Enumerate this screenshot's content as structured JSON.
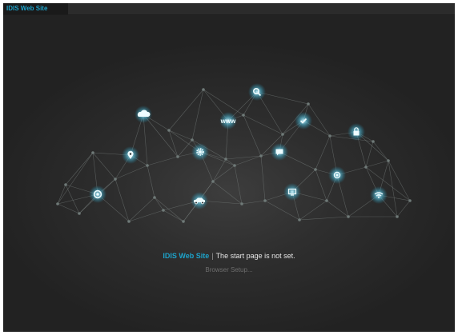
{
  "tab": {
    "label": "IDIS Web Site"
  },
  "status": {
    "site_name": "IDIS Web Site",
    "separator": "|",
    "message": "The start page is not set."
  },
  "setup_link": {
    "label": "Browser Setup..."
  },
  "network": {
    "www_label": "www",
    "icons": [
      "cloud-icon",
      "search-icon",
      "check-icon",
      "lock-icon",
      "location-icon",
      "gear-icon",
      "chat-icon",
      "target-icon",
      "monitor-icon",
      "chrome-icon",
      "car-icon",
      "wifi-icon"
    ]
  },
  "colors": {
    "accent": "#1da2c9",
    "background": "#242424",
    "icon_glow": "#dff8ff"
  }
}
